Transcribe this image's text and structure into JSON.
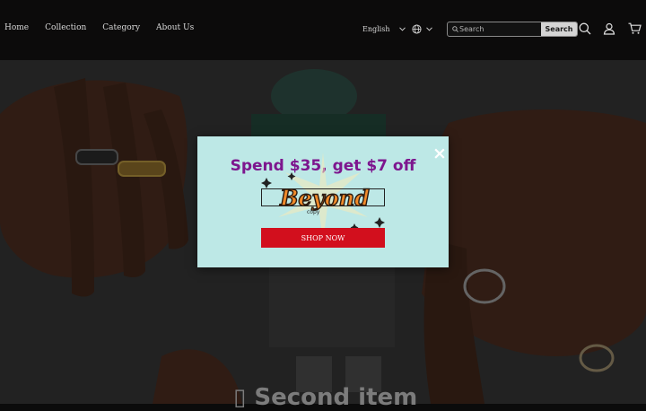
{
  "nav": {
    "items": [
      {
        "label": "Home"
      },
      {
        "label": "Collection"
      },
      {
        "label": "Category"
      },
      {
        "label": "About Us"
      }
    ]
  },
  "language": {
    "label": "English"
  },
  "search": {
    "placeholder": "Search",
    "button_label": "Search"
  },
  "icons": {
    "language_chevron": "chevron-down-icon",
    "globe": "globe-icon",
    "search": "search-icon",
    "account": "user-icon",
    "cart": "cart-icon",
    "close": "close-icon"
  },
  "hero": {
    "title": "▯ Second item"
  },
  "popup": {
    "close_label": "×",
    "title": "Spend $35, get $7 off",
    "logo_text": "Beyond",
    "logo_caption": "copy",
    "shop_button": "SHOP NOW"
  },
  "colors": {
    "header_bg": "#0c0b0b",
    "popup_bg": "#bde8e6",
    "popup_title": "#7d168e",
    "shop_button_bg": "#d20f1d",
    "logo_orange": "#f08a2a"
  }
}
